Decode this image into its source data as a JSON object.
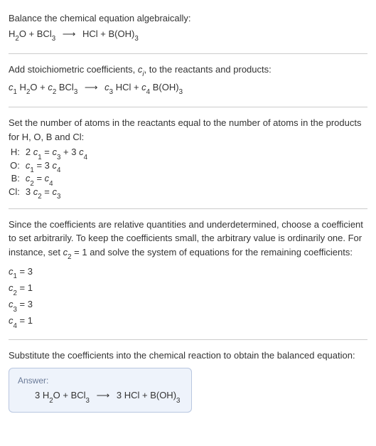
{
  "step1": {
    "instruction": "Balance the chemical equation algebraically:",
    "eq_left_1": "H",
    "eq_left_1_sub": "2",
    "eq_left_1b": "O + BCl",
    "eq_left_1b_sub": "3",
    "arrow": "⟶",
    "eq_right_1": "HCl + B(OH)",
    "eq_right_1_sub": "3"
  },
  "step2": {
    "instruction_a": "Add stoichiometric coefficients, ",
    "ci": "c",
    "ci_sub": "i",
    "instruction_b": ", to the reactants and products:",
    "c1": "c",
    "c1_sub": "1",
    "sp1": " H",
    "sp1_sub": "2",
    "sp1b": "O + ",
    "c2": "c",
    "c2_sub": "2",
    "sp2": " BCl",
    "sp2_sub": "3",
    "arrow": "⟶",
    "c3": "c",
    "c3_sub": "3",
    "sp3": " HCl + ",
    "c4": "c",
    "c4_sub": "4",
    "sp4": " B(OH)",
    "sp4_sub": "3"
  },
  "step3": {
    "instruction": "Set the number of atoms in the reactants equal to the number of atoms in the products for H, O, B and Cl:",
    "rows": [
      {
        "label": "H:",
        "c_a": "2 ",
        "cv_a": "c",
        "cs_a": "1",
        "mid": " = ",
        "cv_b": "c",
        "cs_b": "3",
        "mid2": " + 3 ",
        "cv_c": "c",
        "cs_c": "4"
      },
      {
        "label": "O:",
        "c_a": "",
        "cv_a": "c",
        "cs_a": "1",
        "mid": " = 3 ",
        "cv_b": "c",
        "cs_b": "4",
        "mid2": "",
        "cv_c": "",
        "cs_c": ""
      },
      {
        "label": "B:",
        "c_a": "",
        "cv_a": "c",
        "cs_a": "2",
        "mid": " = ",
        "cv_b": "c",
        "cs_b": "4",
        "mid2": "",
        "cv_c": "",
        "cs_c": ""
      },
      {
        "label": "Cl:",
        "c_a": "3 ",
        "cv_a": "c",
        "cs_a": "2",
        "mid": " = ",
        "cv_b": "c",
        "cs_b": "3",
        "mid2": "",
        "cv_c": "",
        "cs_c": ""
      }
    ]
  },
  "step4": {
    "instruction_a": "Since the coefficients are relative quantities and underdetermined, choose a coefficient to set arbitrarily. To keep the coefficients small, the arbitrary value is ordinarily one. For instance, set ",
    "cv": "c",
    "cs": "2",
    "instruction_b": " = 1 and solve the system of equations for the remaining coefficients:",
    "coefs": [
      {
        "cv": "c",
        "cs": "1",
        "val": " = 3"
      },
      {
        "cv": "c",
        "cs": "2",
        "val": " = 1"
      },
      {
        "cv": "c",
        "cs": "3",
        "val": " = 3"
      },
      {
        "cv": "c",
        "cs": "4",
        "val": " = 1"
      }
    ]
  },
  "step5": {
    "instruction": "Substitute the coefficients into the chemical reaction to obtain the balanced equation:",
    "answer_label": "Answer:",
    "eq_a": "3 H",
    "eq_a_sub": "2",
    "eq_b": "O + BCl",
    "eq_b_sub": "3",
    "arrow": "⟶",
    "eq_c": " 3 HCl + B(OH)",
    "eq_c_sub": "3"
  },
  "chart_data": {
    "type": "table",
    "title": "Balanced chemical equation derivation",
    "unbalanced_equation": "H2O + BCl3 ⟶ HCl + B(OH)3",
    "atom_balance_equations": {
      "H": "2 c1 = c3 + 3 c4",
      "O": "c1 = 3 c4",
      "B": "c2 = c4",
      "Cl": "3 c2 = c3"
    },
    "solved_coefficients": {
      "c1": 3,
      "c2": 1,
      "c3": 3,
      "c4": 1
    },
    "balanced_equation": "3 H2O + BCl3 ⟶ 3 HCl + B(OH)3"
  }
}
